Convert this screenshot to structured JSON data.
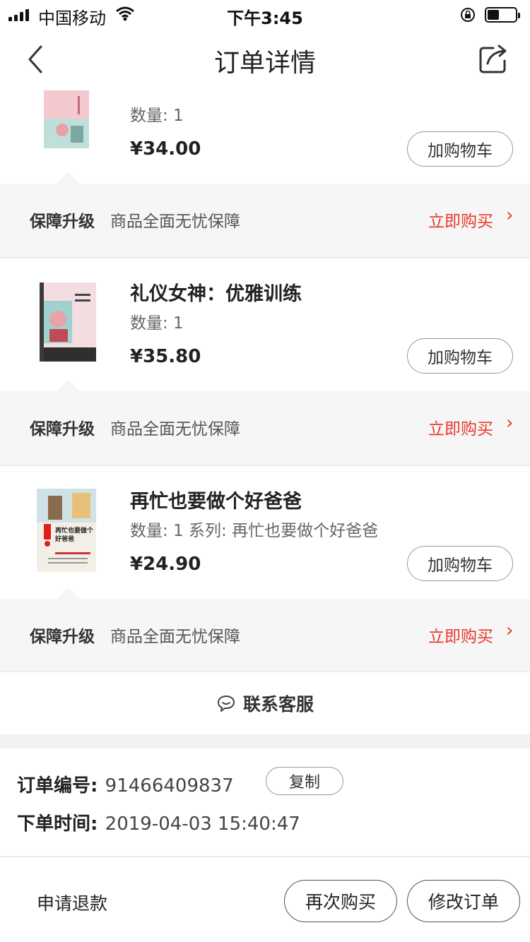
{
  "status_bar": {
    "carrier": "中国移动",
    "time": "下午3:45",
    "icons": [
      "signal-icon",
      "wifi-icon",
      "orientation-lock-icon",
      "battery-icon"
    ]
  },
  "nav": {
    "title": "订单详情",
    "back_icon": "back-arrow-icon",
    "share_icon": "share-icon"
  },
  "items": [
    {
      "title": "",
      "quantity": "数量: 1",
      "price": "¥34.00",
      "cart_label": "加购物车"
    },
    {
      "title": "礼仪女神：优雅训练",
      "quantity": "数量: 1",
      "price": "¥35.80",
      "cart_label": "加购物车"
    },
    {
      "title": "再忙也要做个好爸爸",
      "quantity": "数量: 1 系列: 再忙也要做个好爸爸",
      "price": "¥24.90",
      "cart_label": "加购物车",
      "cover_text": "再忙也要做个好爸爸"
    }
  ],
  "guarantee": {
    "label": "保障升级",
    "desc": "商品全面无忧保障",
    "action": "立即购买",
    "arrow": "›"
  },
  "contact": {
    "label": "联系客服",
    "icon": "chat-bubble-icon"
  },
  "order_info": {
    "number_label": "订单编号:",
    "number_value": "91466409837",
    "copy_label": "复制",
    "time_label": "下单时间:",
    "time_value": "2019-04-03 15:40:47"
  },
  "footer": {
    "refund_label": "申请退款",
    "rebuy_label": "再次购买",
    "modify_label": "修改订单"
  },
  "colors": {
    "accent": "#e8392a",
    "band": "#f6f6f6"
  }
}
